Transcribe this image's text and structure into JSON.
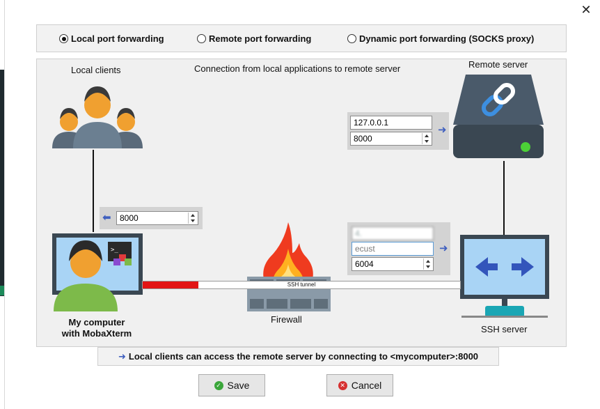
{
  "modes": [
    {
      "label": "Local port forwarding",
      "selected": true
    },
    {
      "label": "Remote port forwarding",
      "selected": false
    },
    {
      "label": "Dynamic port forwarding (SOCKS proxy)",
      "selected": false
    }
  ],
  "diagram": {
    "local_clients_label": "Local clients",
    "connection_label": "Connection from local applications to remote server",
    "remote_server_label": "Remote server",
    "my_computer_label_line1": "My computer",
    "my_computer_label_line2": "with MobaXterm",
    "firewall_label": "Firewall",
    "ssh_server_label": "SSH server",
    "tunnel_label": "SSH tunnel"
  },
  "fields": {
    "remote_host": "127.0.0.1",
    "remote_port": "8000",
    "local_port": "8000",
    "ssh_server_host": "4.",
    "ssh_user": "ecust",
    "ssh_port": "6004"
  },
  "info": {
    "message": "Local clients can access the remote server by connecting to <mycomputer>:8000"
  },
  "buttons": {
    "save": "Save",
    "cancel": "Cancel"
  },
  "colors": {
    "accent_arrow": "#3f5fbf",
    "tunnel_red": "#e21414",
    "status_green": "#4cd137"
  }
}
